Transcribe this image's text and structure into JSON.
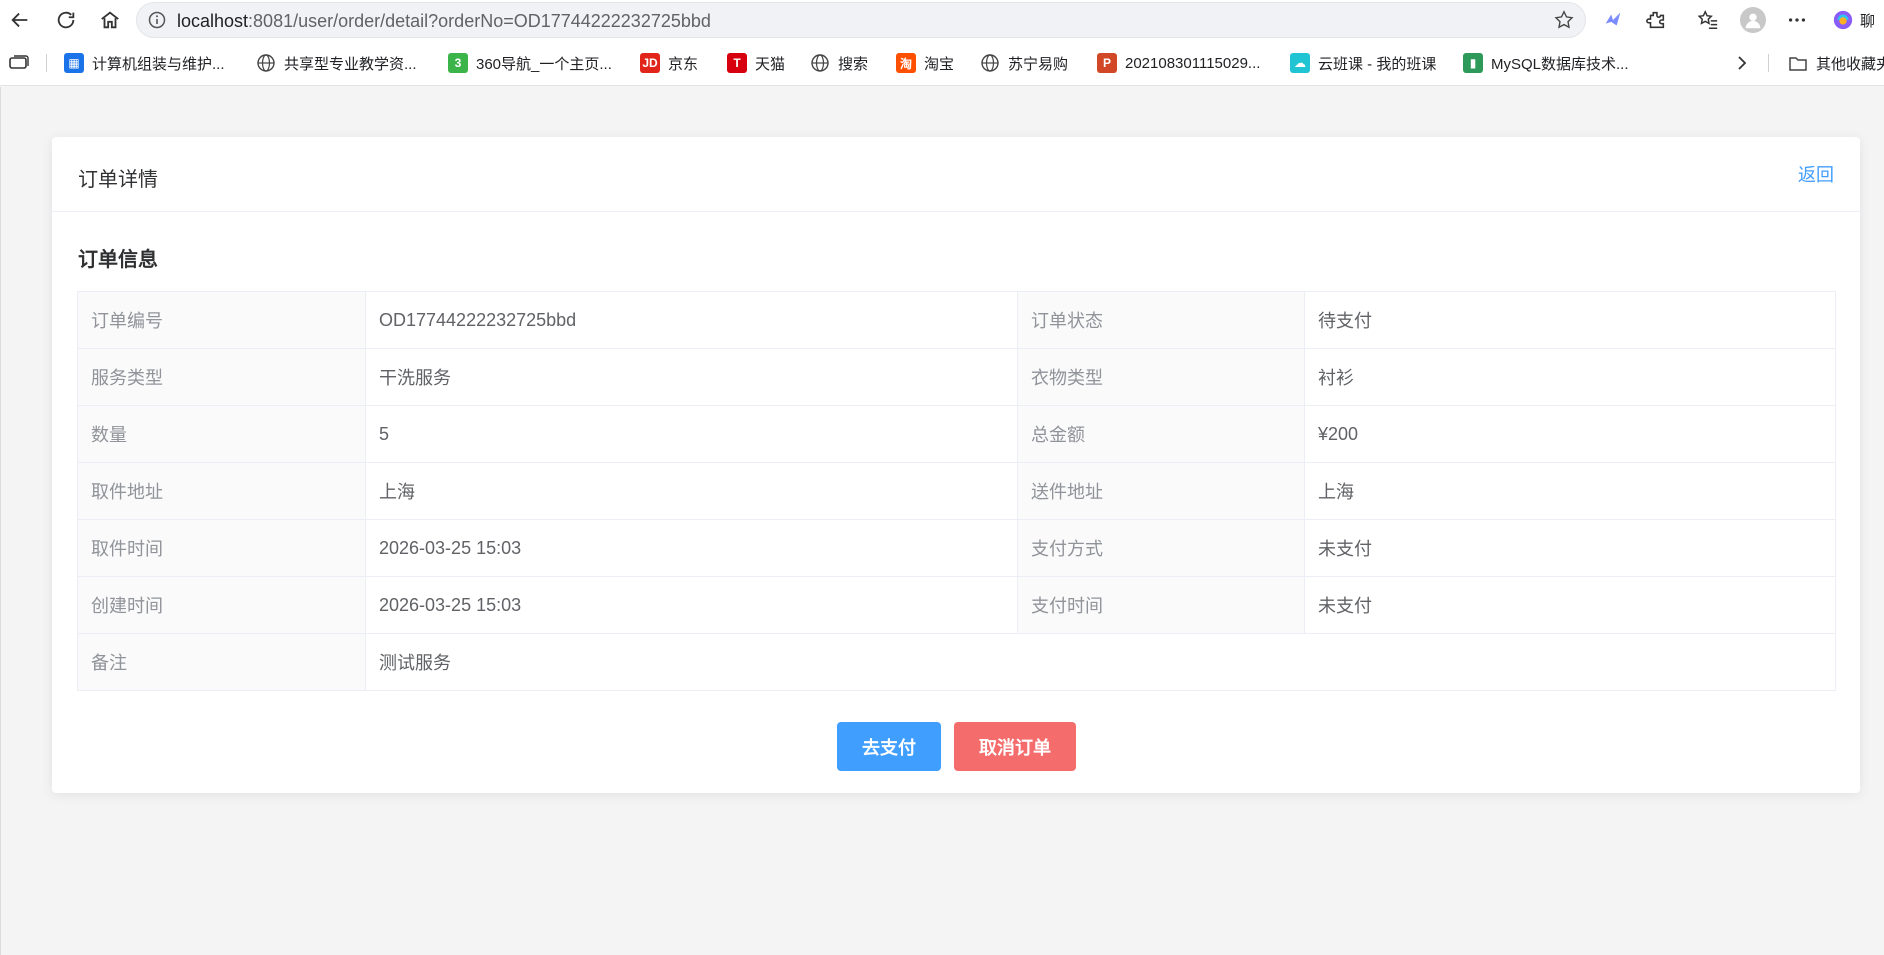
{
  "browser": {
    "url_host": "localhost",
    "url_rest": ":8081/user/order/detail?orderNo=OD17744222232725bbd",
    "profile_label": "聊",
    "bookmarks": [
      {
        "label": "计算机组装与维护...",
        "icon": "app-grid-icon",
        "color": "#1a73e8"
      },
      {
        "label": "共享型专业教学资...",
        "icon": "globe-icon",
        "color": "#5f6368"
      },
      {
        "label": "360导航_一个主页...",
        "icon": "360-icon",
        "color": "#3bb54a"
      },
      {
        "label": "京东",
        "icon": "jd-icon",
        "color": "#e1251b"
      },
      {
        "label": "天猫",
        "icon": "tmall-icon",
        "color": "#d7000f"
      },
      {
        "label": "搜索",
        "icon": "globe-icon",
        "color": "#5f6368"
      },
      {
        "label": "淘宝",
        "icon": "taobao-icon",
        "color": "#ff5000"
      },
      {
        "label": "苏宁易购",
        "icon": "globe-icon",
        "color": "#5f6368"
      },
      {
        "label": "202108301115029...",
        "icon": "powerpoint-icon",
        "color": "#d24726"
      },
      {
        "label": "云班课 - 我的班课",
        "icon": "cloud-class-icon",
        "color": "#21c4d3"
      },
      {
        "label": "MySQL数据库技术...",
        "icon": "book-icon",
        "color": "#2e9a5a"
      }
    ],
    "other_bookmarks": "其他收藏夹"
  },
  "card": {
    "title": "订单详情",
    "back_label": "返回",
    "section_title": "订单信息"
  },
  "order": {
    "order_no_label": "订单编号",
    "order_no": "OD17744222232725bbd",
    "status_label": "订单状态",
    "status": "待支付",
    "service_type_label": "服务类型",
    "service_type": "干洗服务",
    "clothes_type_label": "衣物类型",
    "clothes_type": "衬衫",
    "quantity_label": "数量",
    "quantity": "5",
    "total_label": "总金额",
    "total": "¥200",
    "pickup_addr_label": "取件地址",
    "pickup_addr": "上海",
    "delivery_addr_label": "送件地址",
    "delivery_addr": "上海",
    "pickup_time_label": "取件时间",
    "pickup_time": "2026-03-25 15:03",
    "pay_method_label": "支付方式",
    "pay_method": "未支付",
    "created_label": "创建时间",
    "created": "2026-03-25 15:03",
    "pay_time_label": "支付时间",
    "pay_time": "未支付",
    "remark_label": "备注",
    "remark": "测试服务"
  },
  "actions": {
    "pay_label": "去支付",
    "cancel_label": "取消订单"
  },
  "colors": {
    "primary": "#409eff",
    "danger": "#f56c6c"
  }
}
